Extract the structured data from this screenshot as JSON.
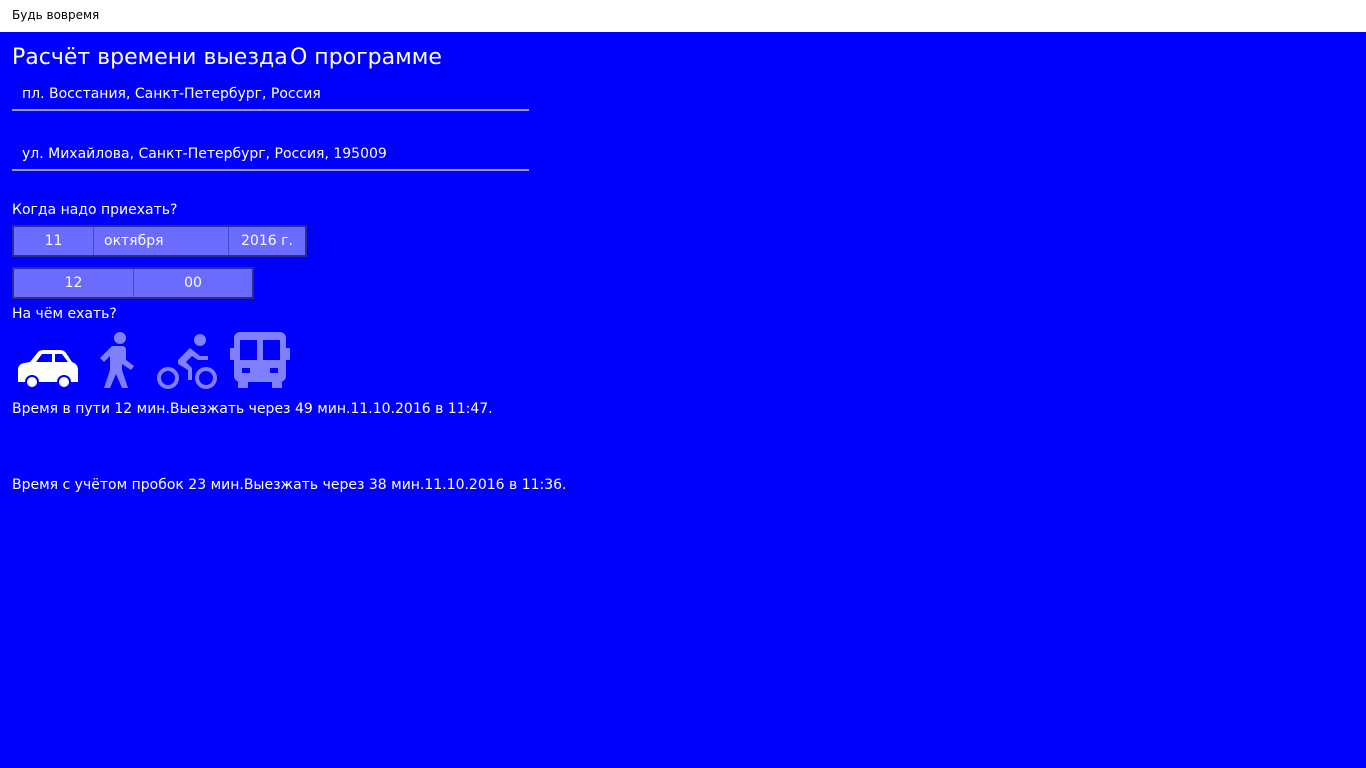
{
  "window": {
    "title": "Будь вовремя"
  },
  "nav": {
    "calc_tab": "Расчёт времени выезда",
    "about_tab": "О программе"
  },
  "route": {
    "from": "пл. Восстания, Санкт-Петербург, Россия",
    "to": "ул. Михайлова, Санкт-Петербург, Россия, 195009"
  },
  "arrival": {
    "label": "Когда надо приехать?",
    "day": "11",
    "month": "октября",
    "year": "2016 г.",
    "hour": "12",
    "minute": "00"
  },
  "transport": {
    "label": "На чём ехать?",
    "modes": [
      {
        "icon": "car-icon",
        "selected": true
      },
      {
        "icon": "walk-icon",
        "selected": false
      },
      {
        "icon": "bike-icon",
        "selected": false
      },
      {
        "icon": "bus-icon",
        "selected": false
      }
    ]
  },
  "results": {
    "travel": "Время в пути 12 мин.Выезжать через 49 мин.11.10.2016 в 11:47.",
    "traffic": "Время с учётом пробок 23 мин.Выезжать через 38 мин.11.10.2016 в 11:36."
  },
  "colors": {
    "background": "#0000FF",
    "selected_icon": "#FFFFFF",
    "unselected_icon": "#8080FF",
    "picker_bg": "#6B6BFF"
  }
}
